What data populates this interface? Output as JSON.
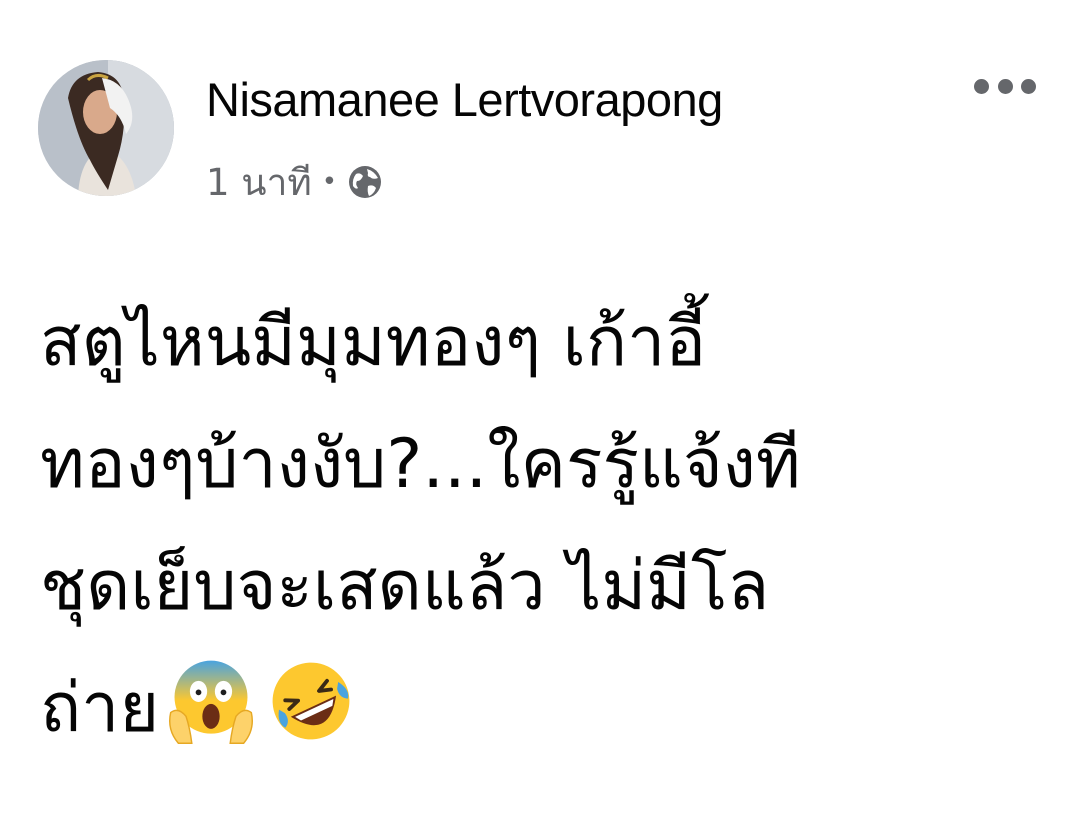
{
  "post": {
    "author": "Nisamanee Lertvorapong",
    "time": "1 นาที",
    "separator": "•",
    "privacy_icon": "globe-icon",
    "menu_icon": "more-options-icon",
    "text_lines": [
      "สตูไหนมีมุมทองๆ เก้าอี้",
      "ทองๆบ้างงับ?...ใครรู้แจ้งที",
      "ชุดเย็บจะเสดแล้ว ไม่มีโล",
      "ถ่าย"
    ],
    "emojis": [
      "face-screaming-in-fear-emoji",
      "rolling-on-the-floor-laughing-emoji"
    ]
  },
  "colors": {
    "text": "#050505",
    "secondary_text": "#65676b",
    "background": "#ffffff",
    "emoji_yellow": "#fdc82f",
    "emoji_blue": "#4aa3df"
  }
}
